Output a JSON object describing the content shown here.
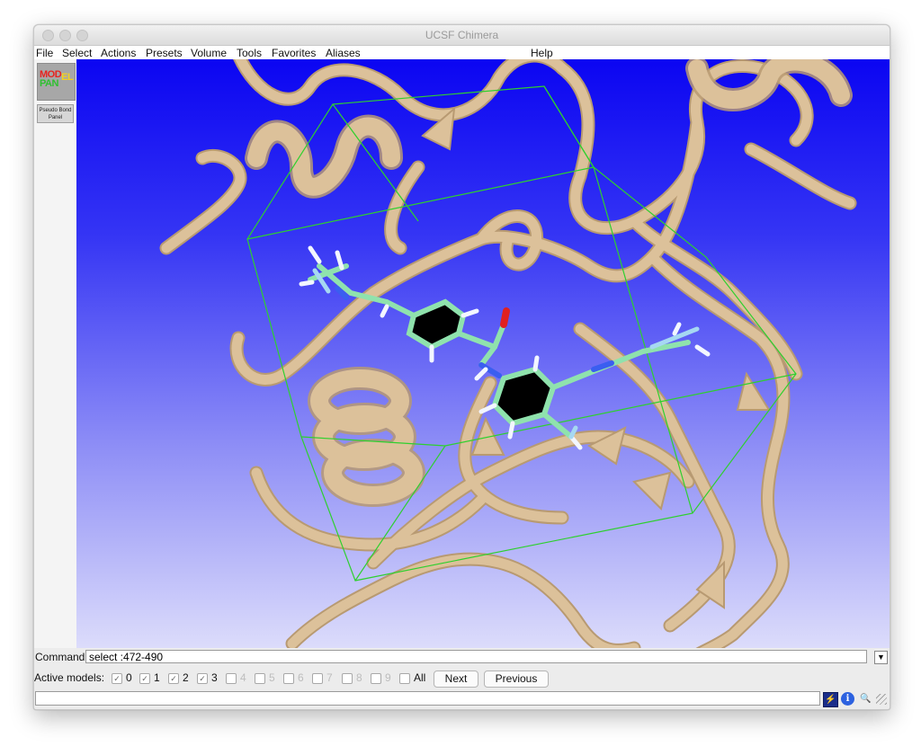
{
  "window": {
    "title": "UCSF Chimera"
  },
  "menubar": {
    "items": [
      "File",
      "Select",
      "Actions",
      "Presets",
      "Volume",
      "Tools",
      "Favorites",
      "Aliases"
    ],
    "help": "Help"
  },
  "sidebar": {
    "model_panel": {
      "line1_a": "MOD",
      "line1_b": "EL",
      "line2": "PAN"
    },
    "pseudobond_panel": {
      "line1": "Pseudo Bond",
      "line2": "Panel"
    }
  },
  "command": {
    "label": "Command:",
    "value": "select :472-490"
  },
  "active_models": {
    "label": "Active models:",
    "models": [
      {
        "label": "0",
        "checked": true,
        "enabled": true
      },
      {
        "label": "1",
        "checked": true,
        "enabled": true
      },
      {
        "label": "2",
        "checked": true,
        "enabled": true
      },
      {
        "label": "3",
        "checked": true,
        "enabled": true
      },
      {
        "label": "4",
        "checked": false,
        "enabled": false
      },
      {
        "label": "5",
        "checked": false,
        "enabled": false
      },
      {
        "label": "6",
        "checked": false,
        "enabled": false
      },
      {
        "label": "7",
        "checked": false,
        "enabled": false
      },
      {
        "label": "8",
        "checked": false,
        "enabled": false
      },
      {
        "label": "9",
        "checked": false,
        "enabled": false
      }
    ],
    "all_label": "All",
    "next_label": "Next",
    "previous_label": "Previous"
  },
  "colors": {
    "ribbon": "#dcc19a",
    "ribbon_edge": "#b89a72",
    "ligand": "#90e8b0",
    "nitrogen": "#3a5ef0",
    "oxygen": "#e02020",
    "hydrogen": "#f2f6ff",
    "bounding_box": "#2ed02e"
  }
}
